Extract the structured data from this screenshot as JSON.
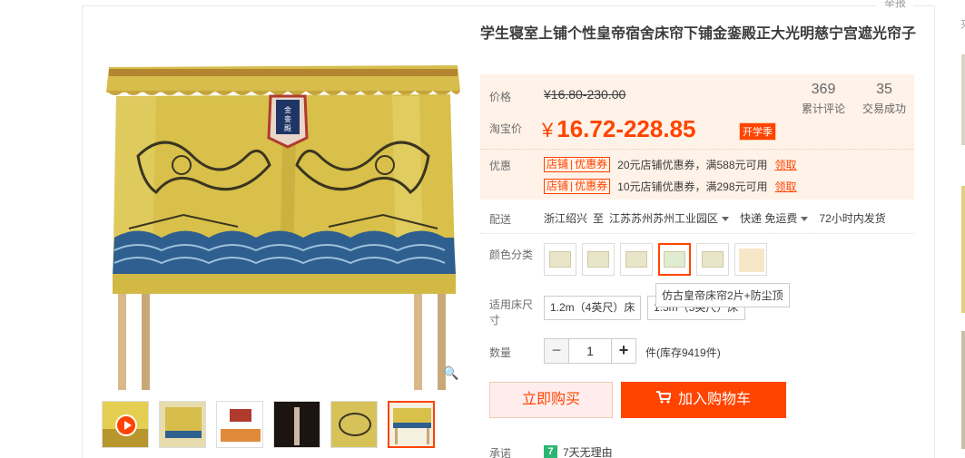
{
  "report_label": "举报",
  "right_edge_text": "来",
  "product": {
    "title": "学生寝室上铺个性皇帝宿舍床帘下铺金銮殿正大光明慈宁宫遮光帘子",
    "banner_text": "金銮殿"
  },
  "price": {
    "label": "价格",
    "original": "¥16.80-230.00",
    "taobao_label": "淘宝价",
    "currency": "¥",
    "value": "16.72-228.85",
    "badge": "开学季"
  },
  "stats": [
    {
      "number": "369",
      "label": "累计评论"
    },
    {
      "number": "35",
      "label": "交易成功"
    }
  ],
  "coupons": {
    "label": "优惠",
    "tag_left": "店铺",
    "tag_right": "优惠券",
    "items": [
      {
        "text": "20元店铺优惠券，满588元可用",
        "claim": "领取"
      },
      {
        "text": "10元店铺优惠券，满298元可用",
        "claim": "领取"
      }
    ]
  },
  "shipping": {
    "label": "配送",
    "from": "浙江绍兴",
    "to_word": "至",
    "destination": "江苏苏州苏州工业园区",
    "method": "快递 免运费",
    "dispatch": "72小时内发货"
  },
  "color": {
    "label": "颜色分类",
    "tooltip": "仿古皇帝床帘2片+防尘顶",
    "selected_index": 3
  },
  "size": {
    "label": "适用床尺寸",
    "options": [
      "1.2m（4英尺）床",
      "1.5m（5英尺）床"
    ]
  },
  "quantity": {
    "label": "数量",
    "minus": "−",
    "value": "1",
    "plus": "+",
    "stock": "件(库存9419件)"
  },
  "actions": {
    "buy_now": "立即购买",
    "add_to_cart": "加入购物车"
  },
  "promise": {
    "label": "承诺",
    "badge": "7",
    "text": "7天无理由"
  },
  "colors": {
    "accent": "#ff4400",
    "price_bg": "#fff2e8",
    "curtain_gold": "#d8c04a",
    "curtain_blue": "#2f5f8f",
    "promise_green": "#2bb673"
  }
}
